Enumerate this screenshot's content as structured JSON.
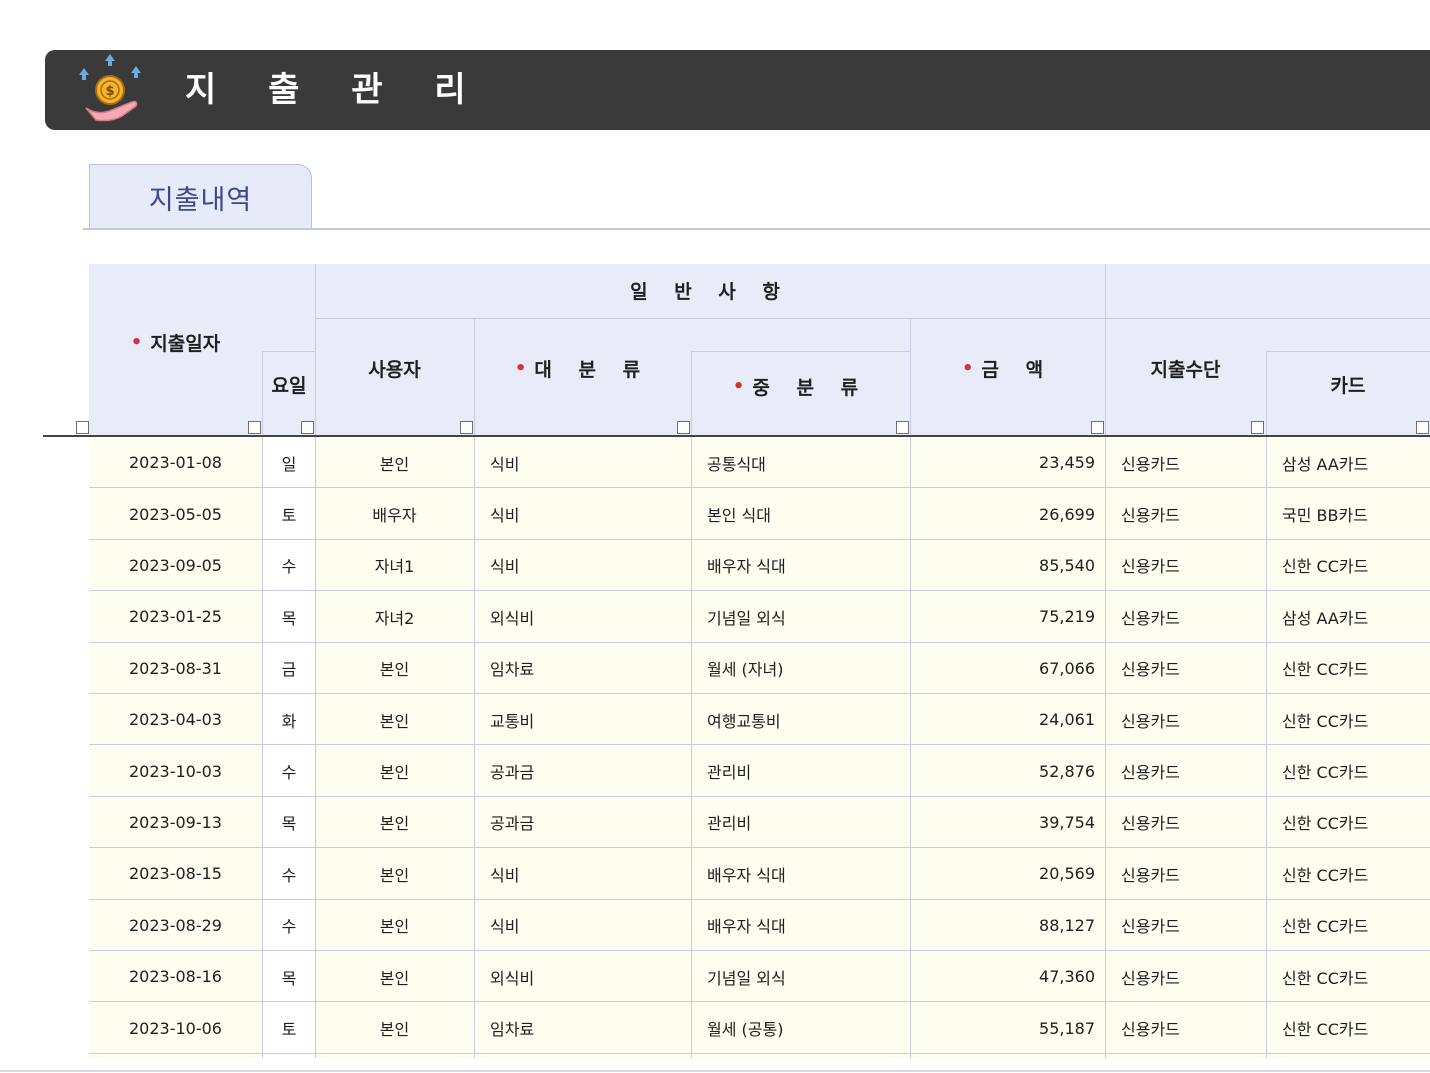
{
  "banner": {
    "title": "지 출 관 리"
  },
  "tab": {
    "label": "지출내역"
  },
  "table": {
    "group_header": "일 반 사 항",
    "headers": {
      "date": "지출일자",
      "day": "요일",
      "user": "사용자",
      "major": "대 분 류",
      "minor": "중 분 류",
      "amount": "금 액",
      "method": "지출수단",
      "card": "카드"
    },
    "rows": [
      {
        "date": "2023-01-08",
        "day": "일",
        "user": "본인",
        "major": "식비",
        "minor": "공통식대",
        "amount": "23,459",
        "method": "신용카드",
        "card": "삼성 AA카드"
      },
      {
        "date": "2023-05-05",
        "day": "토",
        "user": "배우자",
        "major": "식비",
        "minor": "본인 식대",
        "amount": "26,699",
        "method": "신용카드",
        "card": "국민 BB카드"
      },
      {
        "date": "2023-09-05",
        "day": "수",
        "user": "자녀1",
        "major": "식비",
        "minor": "배우자 식대",
        "amount": "85,540",
        "method": "신용카드",
        "card": "신한 CC카드"
      },
      {
        "date": "2023-01-25",
        "day": "목",
        "user": "자녀2",
        "major": "외식비",
        "minor": "기념일 외식",
        "amount": "75,219",
        "method": "신용카드",
        "card": "삼성 AA카드"
      },
      {
        "date": "2023-08-31",
        "day": "금",
        "user": "본인",
        "major": "임차료",
        "minor": "월세 (자녀)",
        "amount": "67,066",
        "method": "신용카드",
        "card": "신한 CC카드"
      },
      {
        "date": "2023-04-03",
        "day": "화",
        "user": "본인",
        "major": "교통비",
        "minor": "여행교통비",
        "amount": "24,061",
        "method": "신용카드",
        "card": "신한 CC카드"
      },
      {
        "date": "2023-10-03",
        "day": "수",
        "user": "본인",
        "major": "공과금",
        "minor": "관리비",
        "amount": "52,876",
        "method": "신용카드",
        "card": "신한 CC카드"
      },
      {
        "date": "2023-09-13",
        "day": "목",
        "user": "본인",
        "major": "공과금",
        "minor": "관리비",
        "amount": "39,754",
        "method": "신용카드",
        "card": "신한 CC카드"
      },
      {
        "date": "2023-08-15",
        "day": "수",
        "user": "본인",
        "major": "식비",
        "minor": "배우자 식대",
        "amount": "20,569",
        "method": "신용카드",
        "card": "신한 CC카드"
      },
      {
        "date": "2023-08-29",
        "day": "수",
        "user": "본인",
        "major": "식비",
        "minor": "배우자 식대",
        "amount": "88,127",
        "method": "신용카드",
        "card": "신한 CC카드"
      },
      {
        "date": "2023-08-16",
        "day": "목",
        "user": "본인",
        "major": "외식비",
        "minor": "기념일 외식",
        "amount": "47,360",
        "method": "신용카드",
        "card": "신한 CC카드"
      },
      {
        "date": "2023-10-06",
        "day": "토",
        "user": "본인",
        "major": "임차료",
        "minor": "월세 (공통)",
        "amount": "55,187",
        "method": "신용카드",
        "card": "신한 CC카드"
      }
    ]
  },
  "colors": {
    "banner": "#3a3a3a",
    "header_bg": "#e8ebf8",
    "body_bg": "#fdfdf0",
    "required_mark": "#d8303a",
    "tab_text": "#3a4a8c"
  },
  "icons": {
    "logo": "coin-hand-icon",
    "filter": "filter-dropdown-icon"
  }
}
